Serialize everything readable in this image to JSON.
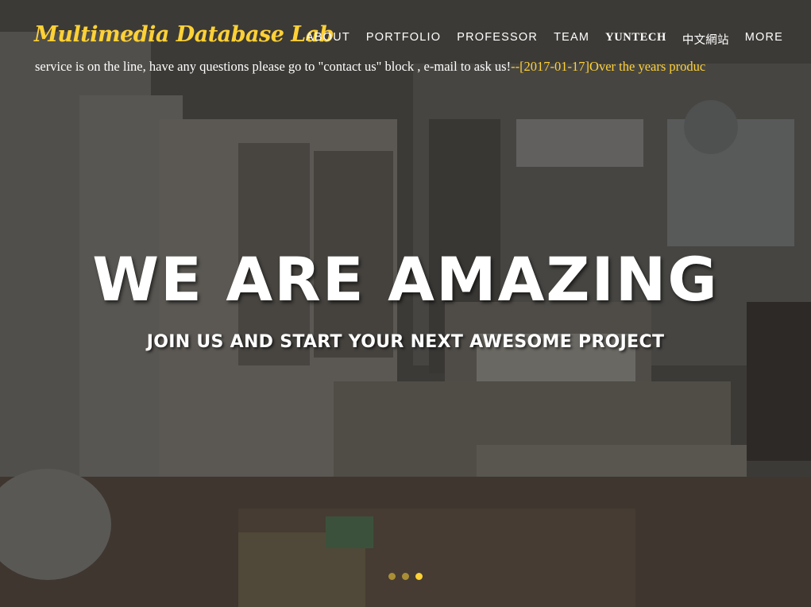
{
  "brand": {
    "title": "Multimedia Database Lab"
  },
  "nav": {
    "items": [
      {
        "label": "ABOUT"
      },
      {
        "label": "PORTFOLIO"
      },
      {
        "label": "PROFESSOR"
      },
      {
        "label": "TEAM"
      },
      {
        "label": "YUNTECH"
      },
      {
        "label": "中文網站"
      },
      {
        "label": "MORE"
      }
    ]
  },
  "marquee": {
    "white_text": "service is on the line, have any questions please go to \"contact us\" block , e-mail to ask us!",
    "gold_text": "--[2017-01-17]Over the years produc"
  },
  "hero": {
    "headline": "WE ARE AMAZING",
    "subheadline": "JOIN US AND START YOUR NEXT AWESOME PROJECT"
  },
  "carousel": {
    "slide_count": 3,
    "active_index": 2
  },
  "colors": {
    "accent": "#fed136",
    "text": "#ffffff"
  }
}
